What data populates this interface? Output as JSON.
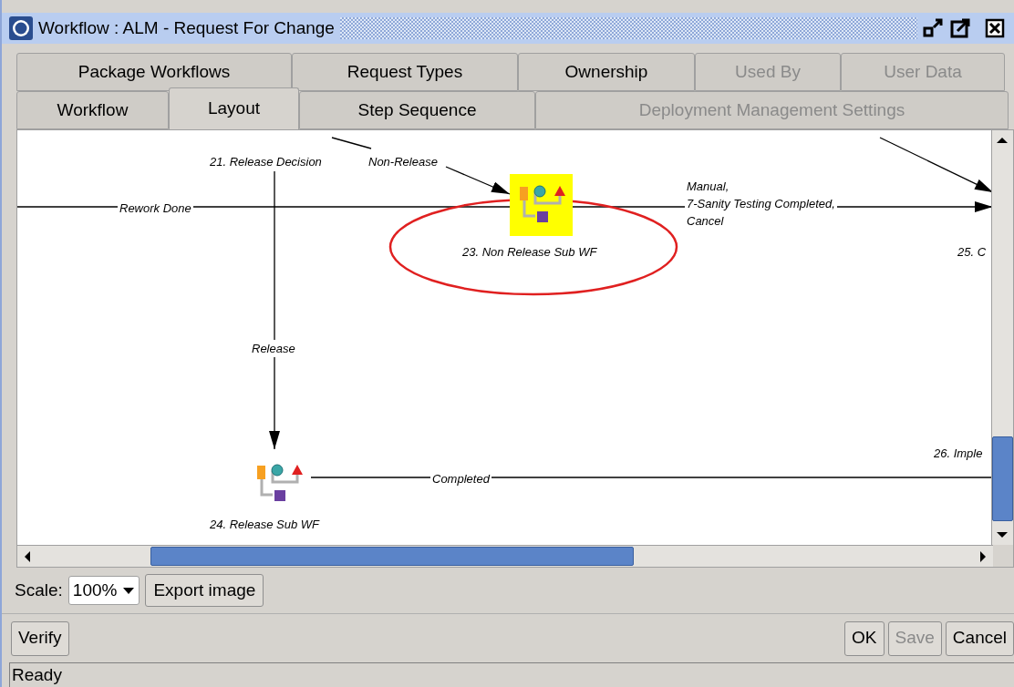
{
  "window": {
    "title": "Workflow : ALM - Request For Change"
  },
  "tabs": [
    [
      {
        "label": "Package Workflows",
        "selected": false,
        "disabled": false
      },
      {
        "label": "Request Types",
        "selected": false,
        "disabled": false
      },
      {
        "label": "Ownership",
        "selected": false,
        "disabled": false
      },
      {
        "label": "Used By",
        "selected": false,
        "disabled": true
      },
      {
        "label": "User Data",
        "selected": false,
        "disabled": true
      }
    ],
    [
      {
        "label": "Workflow",
        "selected": false,
        "disabled": false
      },
      {
        "label": "Layout",
        "selected": true,
        "disabled": false
      },
      {
        "label": "Step Sequence",
        "selected": false,
        "disabled": false
      },
      {
        "label": "Deployment Management Settings",
        "selected": false,
        "disabled": true
      }
    ]
  ],
  "diagram": {
    "steps": [
      {
        "label": "21. Release Decision",
        "kind": "label"
      },
      {
        "label": "23. Non Release Sub WF",
        "kind": "subworkflow",
        "selected": true
      },
      {
        "label": "24. Release Sub WF",
        "kind": "subworkflow",
        "selected": false
      },
      {
        "label": "25. C",
        "kind": "label"
      },
      {
        "label": "26. Imple",
        "kind": "label"
      }
    ],
    "transitions": [
      {
        "lines": [
          "Rework Done"
        ]
      },
      {
        "lines": [
          "Non-Release"
        ]
      },
      {
        "lines": [
          "Manual,",
          "7-Sanity Testing Completed,",
          "Cancel"
        ]
      },
      {
        "lines": [
          "Release"
        ]
      },
      {
        "lines": [
          "Completed"
        ]
      }
    ]
  },
  "scale": {
    "label": "Scale:",
    "value": "100%"
  },
  "export_button": "Export image",
  "buttons": [
    {
      "label": "Verify",
      "disabled": false
    },
    {
      "label": "OK",
      "disabled": false
    },
    {
      "label": "Save",
      "disabled": true
    },
    {
      "label": "Cancel",
      "disabled": false
    }
  ],
  "status_bar": "Ready"
}
